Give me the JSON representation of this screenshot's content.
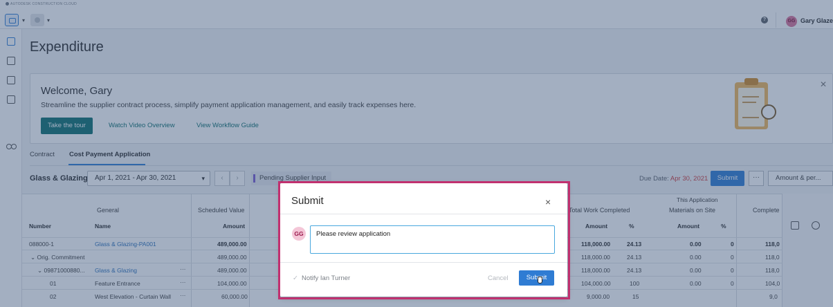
{
  "app": {
    "brand": "AUTODESK CONSTRUCTION CLOUD"
  },
  "user": {
    "initials": "GG",
    "name": "Gary Glaze"
  },
  "page": {
    "title": "Expenditure"
  },
  "welcome": {
    "title": "Welcome, Gary",
    "subtitle": "Streamline the supplier contract process, simplify payment application management, and easily track expenses here.",
    "tour_label": "Take the tour",
    "video_label": "Watch Video Overview",
    "guide_label": "View Workflow Guide"
  },
  "tabs": [
    {
      "label": "Contract"
    },
    {
      "label": "Cost Payment Application"
    }
  ],
  "toolbar": {
    "title": "Glass & Glazing",
    "date_range": "Apr 1, 2021 - Apr 30, 2021",
    "status": "Pending Supplier Input",
    "due_label": "Due Date:",
    "due_date": "Apr 30, 2021",
    "submit_label": "Submit",
    "more_label": "···",
    "view_select": "Amount & per..."
  },
  "grid": {
    "group_headers": {
      "general": "General",
      "scheduled_value": "Scheduled Value",
      "this_application": "This Application",
      "total_work": "Total Work Completed",
      "materials": "Materials on Site",
      "completed": "Complete"
    },
    "col_headers": {
      "number": "Number",
      "name": "Name",
      "amount": "Amount",
      "tw_amount": "Amount",
      "tw_pct": "%",
      "mat_amount": "Amount",
      "mat_pct": "%"
    },
    "rows": [
      {
        "number": "088000-1",
        "name": "Glass & Glazing-PA001",
        "sched": "489,000.00",
        "tw_amt": "118,000.00",
        "tw_pct": "24.13",
        "mat_amt": "0.00",
        "mat_pct": "0",
        "comp": "118,0"
      },
      {
        "number": "Orig. Commitment",
        "name": "",
        "sched": "489,000.00",
        "tw_amt": "118,000.00",
        "tw_pct": "24.13",
        "mat_amt": "0.00",
        "mat_pct": "0",
        "comp": "118,0"
      },
      {
        "number": "09871000880...",
        "name": "Glass & Glazing",
        "sched": "489,000.00",
        "tw_amt": "118,000.00",
        "tw_pct": "24.13",
        "mat_amt": "0.00",
        "mat_pct": "0",
        "comp": "118,0"
      },
      {
        "number": "01",
        "name": "Feature Entrance",
        "sched": "104,000.00",
        "tw_amt": "104,000.00",
        "tw_pct": "100",
        "mat_amt": "0.00",
        "mat_pct": "0",
        "comp": "104,0"
      },
      {
        "number": "02",
        "name": "West Elevation - Curtain Wall",
        "sched": "60,000.00",
        "tw_amt": "9,000.00",
        "tw_pct": "15",
        "mat_amt": "",
        "mat_pct": "",
        "comp": "9,0"
      }
    ]
  },
  "dialog": {
    "title": "Submit",
    "close": "×",
    "avatar": "GG",
    "comment": "Please review application",
    "notify": "Notify Ian Turner",
    "cancel_label": "Cancel",
    "submit_label": "Submit"
  },
  "colors": {
    "accent": "#2f7cd3",
    "teal": "#0e6f6f",
    "highlight": "#c1306f",
    "overlay": "#344e76",
    "due": "#d03a3a"
  }
}
